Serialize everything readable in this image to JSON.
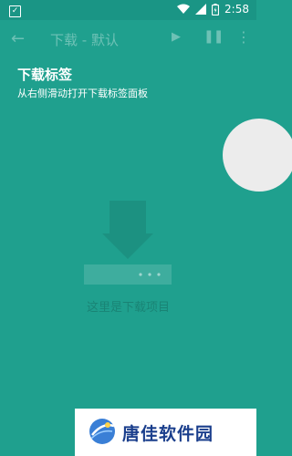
{
  "statusbar": {
    "notification_icon": "check-notification-icon",
    "time": "2:58"
  },
  "toolbar": {
    "title": "下载 - 默认"
  },
  "hint": {
    "title": "下载标签",
    "subtitle": "从右侧滑动打开下载标签面板"
  },
  "empty_state": {
    "text": "这里是下载项目"
  },
  "watermark": {
    "text": "唐佳软件园"
  },
  "colors": {
    "background": "#1fa08e",
    "statusbar": "#1a9585",
    "handle": "#ececec",
    "watermark_text": "#1a3e8c"
  }
}
